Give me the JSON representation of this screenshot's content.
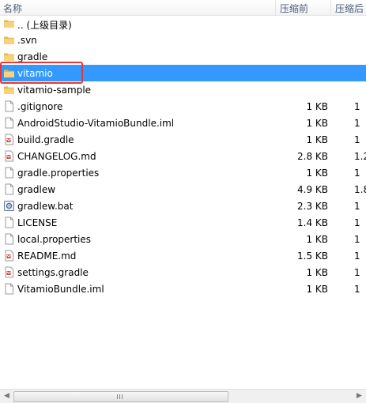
{
  "header": {
    "name": "名称",
    "compressed_before": "压缩前",
    "compressed_after": "压缩后"
  },
  "colors": {
    "selection": "#3399ff",
    "highlight_border": "#e53935"
  },
  "rows": [
    {
      "name": ".. (上级目录)",
      "icon": "folder-icon",
      "size": "",
      "size2": ""
    },
    {
      "name": ".svn",
      "icon": "folder-icon",
      "size": "",
      "size2": ""
    },
    {
      "name": "gradle",
      "icon": "folder-icon",
      "size": "",
      "size2": ""
    },
    {
      "name": "vitamio",
      "icon": "folder-icon",
      "size": "",
      "size2": "",
      "selected": true
    },
    {
      "name": "vitamio-sample",
      "icon": "folder-icon",
      "size": "",
      "size2": ""
    },
    {
      "name": ".gitignore",
      "icon": "file-icon",
      "size": "1 KB",
      "size2": "1"
    },
    {
      "name": "AndroidStudio-VitamioBundle.iml",
      "icon": "file-icon",
      "size": "1 KB",
      "size2": "1"
    },
    {
      "name": "build.gradle",
      "icon": "gradle-file-icon",
      "size": "1 KB",
      "size2": "1"
    },
    {
      "name": "CHANGELOG.md",
      "icon": "gradle-file-icon",
      "size": "2.8 KB",
      "size2": "1.2"
    },
    {
      "name": "gradle.properties",
      "icon": "file-icon",
      "size": "1 KB",
      "size2": "1"
    },
    {
      "name": "gradlew",
      "icon": "file-icon",
      "size": "4.9 KB",
      "size2": "1.8"
    },
    {
      "name": "gradlew.bat",
      "icon": "bat-file-icon",
      "size": "2.3 KB",
      "size2": "1"
    },
    {
      "name": "LICENSE",
      "icon": "file-icon",
      "size": "1.4 KB",
      "size2": "1"
    },
    {
      "name": "local.properties",
      "icon": "file-icon",
      "size": "1 KB",
      "size2": "1"
    },
    {
      "name": "README.md",
      "icon": "gradle-file-icon",
      "size": "1.5 KB",
      "size2": "1"
    },
    {
      "name": "settings.gradle",
      "icon": "gradle-file-icon",
      "size": "1 KB",
      "size2": "1"
    },
    {
      "name": "VitamioBundle.iml",
      "icon": "file-icon",
      "size": "1 KB",
      "size2": "1"
    }
  ],
  "scroll": {
    "left_arrow": "◀",
    "right_arrow": "▶"
  }
}
